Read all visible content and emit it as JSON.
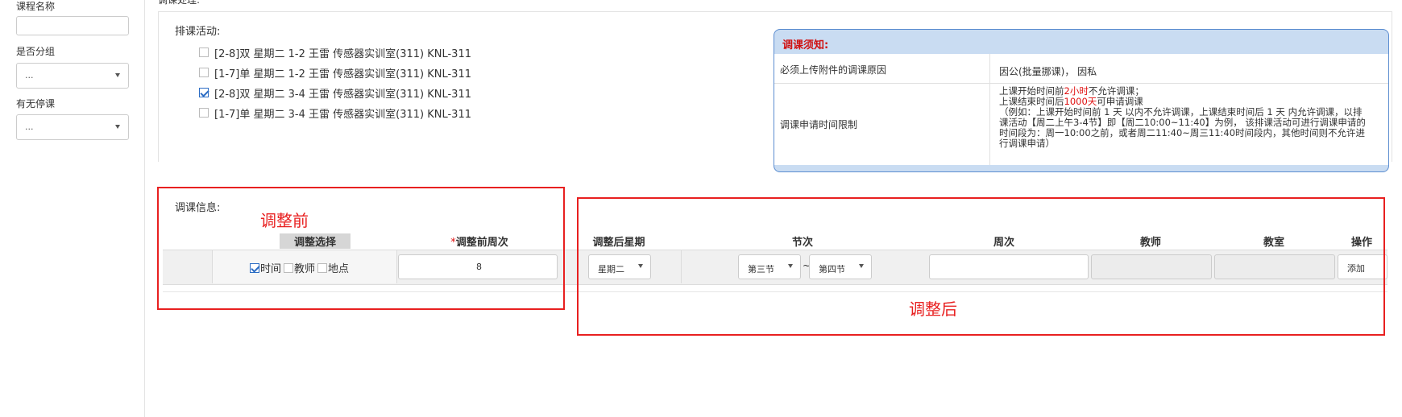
{
  "sidebar": {
    "course_name_label": "课程名称",
    "grouped_label": "是否分组",
    "grouped_value": "...",
    "suspended_label": "有无停课",
    "suspended_value": "..."
  },
  "panel": {
    "cut_title": "调课处理:",
    "activity_label": "排课活动:",
    "activities": [
      {
        "text": "[2-8]双 星期二 1-2 王雷 传感器实训室(311) KNL-311",
        "checked": false
      },
      {
        "text": "[1-7]单 星期二 1-2 王雷 传感器实训室(311) KNL-311",
        "checked": false
      },
      {
        "text": "[2-8]双 星期二 3-4 王雷 传感器实训室(311) KNL-311",
        "checked": true
      },
      {
        "text": "[1-7]单 星期二 3-4 王雷 传感器实训室(311) KNL-311",
        "checked": false
      }
    ]
  },
  "notice": {
    "title": "调课须知:",
    "row1_label": "必须上传附件的调课原因",
    "row1_value": "因公(批量挪课)， 因私",
    "row2_label": "调课申请时间限制",
    "row2_l1_a": "上课开始时间前",
    "row2_l1_b": "2小时",
    "row2_l1_c": "不允许调课；",
    "row2_l2_a": "上课结束时间后",
    "row2_l2_b": "1000天",
    "row2_l2_c": "可申请调课",
    "row2_l3": "（例如：上课开始时间前 1 天 以内不允许调课，上课结束时间后 1 天 内允许调课，以排",
    "row2_l4": "课活动【周二上午3-4节】即【周二10:00~11:40】为例， 该排课活动可进行调课申请的",
    "row2_l5": "时间段为：周一10:00之前，或者周二11:40~周三11:40时间段内，其他时间则不允许进",
    "row2_l6": "行调课申请）"
  },
  "schedule": {
    "info_label": "调课信息:",
    "before_annotation": "调整前",
    "after_annotation": "调整后",
    "headers": {
      "select": "调整选择",
      "required_star": "*",
      "week_before": "调整前周次",
      "day_after": "调整后星期",
      "period": "节次",
      "weeks": "周次",
      "teacher": "教师",
      "room": "教室",
      "op": "操作"
    },
    "options": {
      "time": "时间",
      "teacher": "教师",
      "location": "地点"
    },
    "week_before_value": "8",
    "day_value": "星期二",
    "period_from": "第三节",
    "tilde": "~",
    "period_to": "第四节",
    "add_label": "添加"
  }
}
